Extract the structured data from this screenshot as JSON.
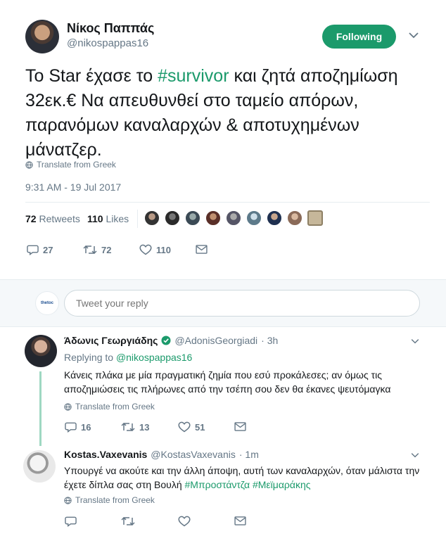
{
  "tweet": {
    "author_name": "Νίκος Παππάς",
    "handle": "@nikospappas16",
    "follow_button": "Following",
    "text_part1": "Το Star έχασε το ",
    "hashtag": "#survivor",
    "text_part2": " και ζητά αποζημίωση 32εκ.€  Να απευθυνθεί στο ταμείο απόρων, παρανόμων καναλαρχών & αποτυχημένων μάνατζερ.",
    "translate": "Translate from Greek",
    "timestamp": "9:31 AM - 19 Jul 2017",
    "retweets_count": "72",
    "retweets_label": "Retweets",
    "likes_count": "110",
    "likes_label": "Likes",
    "actions": {
      "replies": "27",
      "retweets": "72",
      "likes": "110"
    }
  },
  "reply_box": {
    "placeholder": "Tweet your reply",
    "avatar_label": "thetoc"
  },
  "replies": [
    {
      "name": "Άδωνις Γεωργιάδης",
      "handle": "@AdonisGeorgiadi",
      "time": "· 3h",
      "replying_to_label": "Replying to ",
      "replying_to": "@nikospappas16",
      "text": "Κάνεις πλάκα με μία πραγματική ζημία που εσύ προκάλεσες; αν όμως τις αποζημιώσεις τις πλήρωνες από την τσέπη σου δεν θα έκανες ψευτόμαγκα",
      "translate": "Translate from Greek",
      "actions": {
        "replies": "16",
        "retweets": "13",
        "likes": "51"
      }
    },
    {
      "name": "Kostas.Vaxevanis",
      "handle": "@KostasVaxevanis",
      "time": "· 1m",
      "text": "Υπουργέ να ακούτε και την άλλη άποψη, αυτή των καναλαρχών, όταν μάλιστα την έχετε δίπλα σας στη Βουλή ",
      "hashtags": "#Μπροστάντζα #Μεϊμαράκης",
      "translate": "Translate from Greek"
    }
  ],
  "colors": {
    "accent": "#1b9a6b",
    "muted": "#657786",
    "divider": "#e6ecf0"
  }
}
